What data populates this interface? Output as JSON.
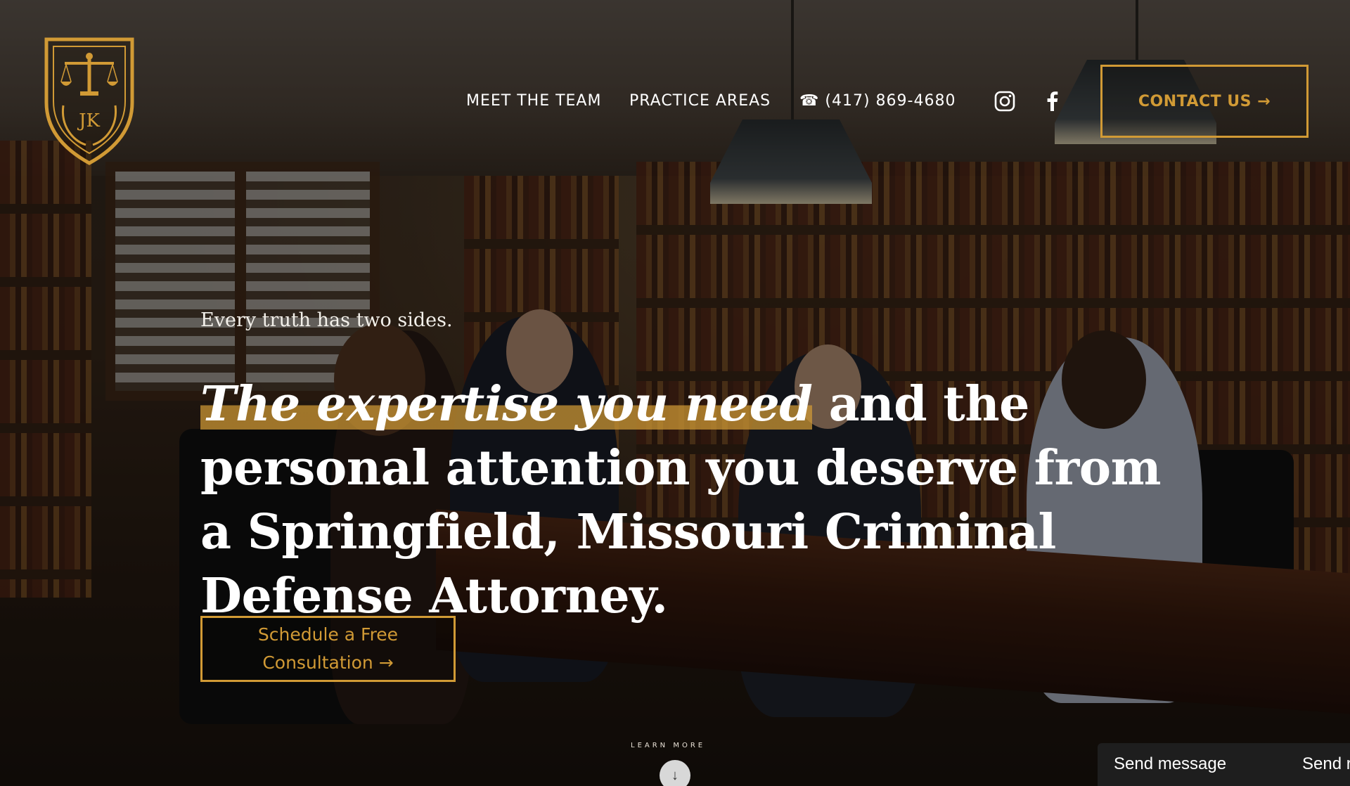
{
  "brand": {
    "logo_initials": "JK",
    "accent_color": "#d19a35"
  },
  "nav": {
    "meet_team": "MEET THE TEAM",
    "practice_areas": "PRACTICE AREAS",
    "phone": "(417) 869-4680",
    "phone_icon": "☎",
    "social": [
      "instagram-icon",
      "facebook-icon"
    ],
    "contact_label": "CONTACT US →"
  },
  "hero": {
    "tagline": "Every truth has two sides.",
    "headline_highlight": "The expertise you need",
    "headline_rest": " and the personal attention you deserve from a Springfield, Missouri Criminal Defense Attorney.",
    "cta_line1": "Schedule a Free",
    "cta_line2": "Consultation →",
    "learn_more": "LEARN MORE",
    "scroll_icon": "↓"
  },
  "chat": {
    "send_label": "Send message",
    "send_label_2": "Send r"
  }
}
